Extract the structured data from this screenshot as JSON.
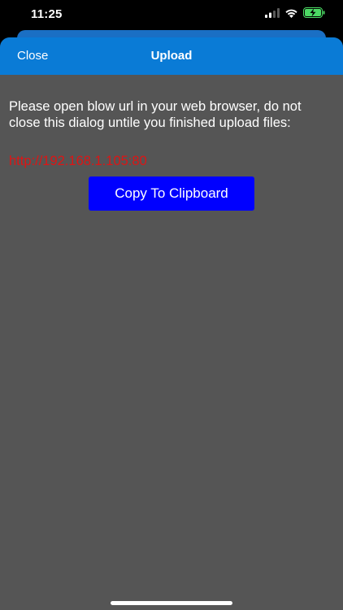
{
  "status_bar": {
    "time": "11:25",
    "icons": [
      "cellular-signal-icon",
      "wifi-icon",
      "battery-charging-icon"
    ]
  },
  "nav": {
    "close_label": "Close",
    "title": "Upload"
  },
  "content": {
    "message": "Please open blow url in your web browser, do not close this dialog untile you finished upload files:",
    "url": "http://192.168.1.105:80",
    "copy_button_label": "Copy To Clipboard"
  },
  "colors": {
    "nav_bar": "#0a7bd6",
    "background": "#555555",
    "url_text": "#dd1515",
    "button": "#0000ff",
    "battery": "#4cd964"
  }
}
